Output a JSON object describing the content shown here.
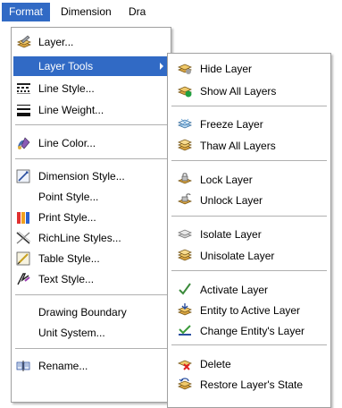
{
  "menubar": {
    "items": [
      {
        "label": "Format",
        "active": true
      },
      {
        "label": "Dimension",
        "active": false
      },
      {
        "label": "Dra",
        "active": false
      }
    ]
  },
  "format_menu": {
    "items": [
      {
        "label": "Layer...",
        "icon": "layer-icon"
      },
      {
        "label": "Layer Tools",
        "icon": "",
        "has_submenu": true,
        "highlighted": true
      },
      {
        "label": "Line Style...",
        "icon": "line-style-icon"
      },
      {
        "label": "Line Weight...",
        "icon": "line-weight-icon"
      },
      {
        "label": "Line Color...",
        "icon": "line-color-icon"
      },
      {
        "label": "Dimension Style...",
        "icon": "dimension-style-icon"
      },
      {
        "label": "Point Style...",
        "icon": ""
      },
      {
        "label": "Print Style...",
        "icon": "print-style-icon"
      },
      {
        "label": "RichLine Styles...",
        "icon": "richline-styles-icon"
      },
      {
        "label": "Table Style...",
        "icon": "table-style-icon"
      },
      {
        "label": "Text Style...",
        "icon": "text-style-icon"
      },
      {
        "label": "Drawing Boundary",
        "icon": ""
      },
      {
        "label": "Unit System...",
        "icon": ""
      },
      {
        "label": "Rename...",
        "icon": "rename-icon"
      }
    ]
  },
  "layer_tools_submenu": {
    "items": [
      {
        "label": "Hide Layer",
        "icon": "hide-layer-icon"
      },
      {
        "label": "Show All Layers",
        "icon": "show-all-layers-icon"
      },
      {
        "label": "Freeze Layer",
        "icon": "freeze-layer-icon"
      },
      {
        "label": "Thaw All Layers",
        "icon": "thaw-all-layers-icon"
      },
      {
        "label": "Lock Layer",
        "icon": "lock-layer-icon"
      },
      {
        "label": "Unlock Layer",
        "icon": "unlock-layer-icon"
      },
      {
        "label": "Isolate Layer",
        "icon": "isolate-layer-icon"
      },
      {
        "label": "Unisolate Layer",
        "icon": "unisolate-layer-icon"
      },
      {
        "label": "Activate Layer",
        "icon": "activate-layer-icon"
      },
      {
        "label": "Entity to Active Layer",
        "icon": "entity-to-active-layer-icon"
      },
      {
        "label": "Change Entity's Layer",
        "icon": "change-entity-layer-icon"
      },
      {
        "label": "Delete",
        "icon": "delete-layer-icon"
      },
      {
        "label": "Restore Layer's State",
        "icon": "restore-layer-state-icon"
      }
    ]
  },
  "colors": {
    "highlight": "#316ac5",
    "highlight_text": "#ffffff",
    "menu_bg": "#ffffff",
    "separator": "#b0b0b0"
  }
}
